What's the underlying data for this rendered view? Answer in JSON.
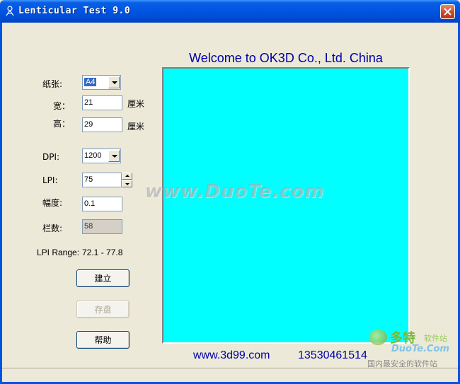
{
  "window": {
    "title": "Lenticular Test 9.0"
  },
  "form": {
    "paper": {
      "label": "纸张:",
      "value": "A4"
    },
    "width": {
      "label": "宽：",
      "value": "21",
      "unit": "厘米"
    },
    "height": {
      "label": "高：",
      "value": "29",
      "unit": "厘米"
    },
    "dpi": {
      "label": "DPI:",
      "value": "1200"
    },
    "lpi": {
      "label": "LPI:",
      "value": "75"
    },
    "amplitude": {
      "label": "幅度:",
      "value": "0.1"
    },
    "columns": {
      "label": "栏数:",
      "value": "58"
    },
    "lpi_range": {
      "label": "LPI Range:",
      "value": "72.1 - 77.8"
    }
  },
  "buttons": {
    "build": "建立",
    "save": "存盘",
    "help": "帮助"
  },
  "preview": {
    "welcome": "Welcome to OK3D Co., Ltd. China",
    "color": "#00ffff",
    "url": "www.3d99.com",
    "phone": "13530461514"
  },
  "watermarks": {
    "center": "www.DuoTe.com",
    "brand": "多特",
    "brand_sub": "软件站",
    "site": "DuoTe.Com",
    "tagline": "国内最安全的软件站"
  }
}
